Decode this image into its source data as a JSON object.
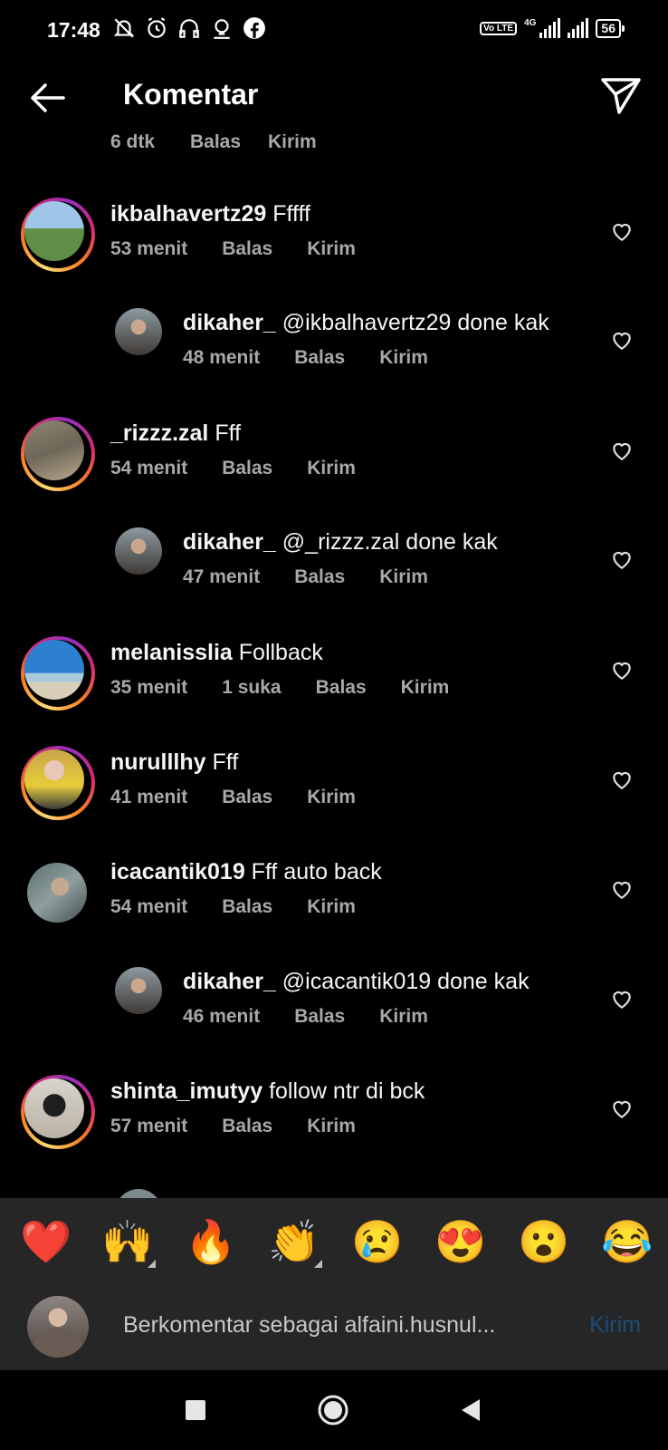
{
  "status_bar": {
    "time": "17:48",
    "icons": [
      "mute-bell-icon",
      "alarm-icon",
      "headphones-icon",
      "podcast-icon",
      "facebook-icon"
    ],
    "network": "4G",
    "volte": "Vo LTE",
    "battery": "56"
  },
  "header": {
    "title": "Komentar",
    "back_icon": "arrow-left-icon",
    "share_icon": "paper-plane-icon"
  },
  "cutoff_meta": {
    "time": "6 dtk",
    "reply": "Balas",
    "send": "Kirim"
  },
  "comments": [
    {
      "username": "ikbalhavertz29",
      "text": "Fffff",
      "time": "53 menit",
      "reply": "Balas",
      "send": "Kirim",
      "reply_level": 0,
      "story_ring": true
    },
    {
      "username": "dikaher_",
      "text": "@ikbalhavertz29 done kak",
      "time": "48 menit",
      "reply": "Balas",
      "send": "Kirim",
      "reply_level": 1
    },
    {
      "username": "_rizzz.zal",
      "text": "Fff",
      "time": "54 menit",
      "reply": "Balas",
      "send": "Kirim",
      "reply_level": 0,
      "story_ring": true
    },
    {
      "username": "dikaher_",
      "text": "@_rizzz.zal done kak",
      "time": "47 menit",
      "reply": "Balas",
      "send": "Kirim",
      "reply_level": 1
    },
    {
      "username": "melanisslia",
      "text": "Follback",
      "time": "35 menit",
      "likes": "1 suka",
      "reply": "Balas",
      "send": "Kirim",
      "reply_level": 0,
      "story_ring": true
    },
    {
      "username": "nurulllhy",
      "text": "Fff",
      "time": "41 menit",
      "reply": "Balas",
      "send": "Kirim",
      "reply_level": 0,
      "story_ring": true
    },
    {
      "username": "icacantik019",
      "text": "Fff auto back",
      "time": "54 menit",
      "reply": "Balas",
      "send": "Kirim",
      "reply_level": 0,
      "story_ring": false
    },
    {
      "username": "dikaher_",
      "text": "@icacantik019 done kak",
      "time": "46 menit",
      "reply": "Balas",
      "send": "Kirim",
      "reply_level": 1
    },
    {
      "username": "shinta_imutyy",
      "text": "follow ntr di bck",
      "time": "57 menit",
      "reply": "Balas",
      "send": "Kirim",
      "reply_level": 0,
      "story_ring": true
    }
  ],
  "reactions": [
    "❤️",
    "🙌",
    "🔥",
    "👏",
    "😢",
    "😍",
    "😮",
    "😂"
  ],
  "composer": {
    "placeholder": "Berkomentar sebagai alfaini.husnul...",
    "post_label": "Kirim"
  },
  "nav": [
    "recents-square-icon",
    "home-circle-icon",
    "back-triangle-icon"
  ]
}
